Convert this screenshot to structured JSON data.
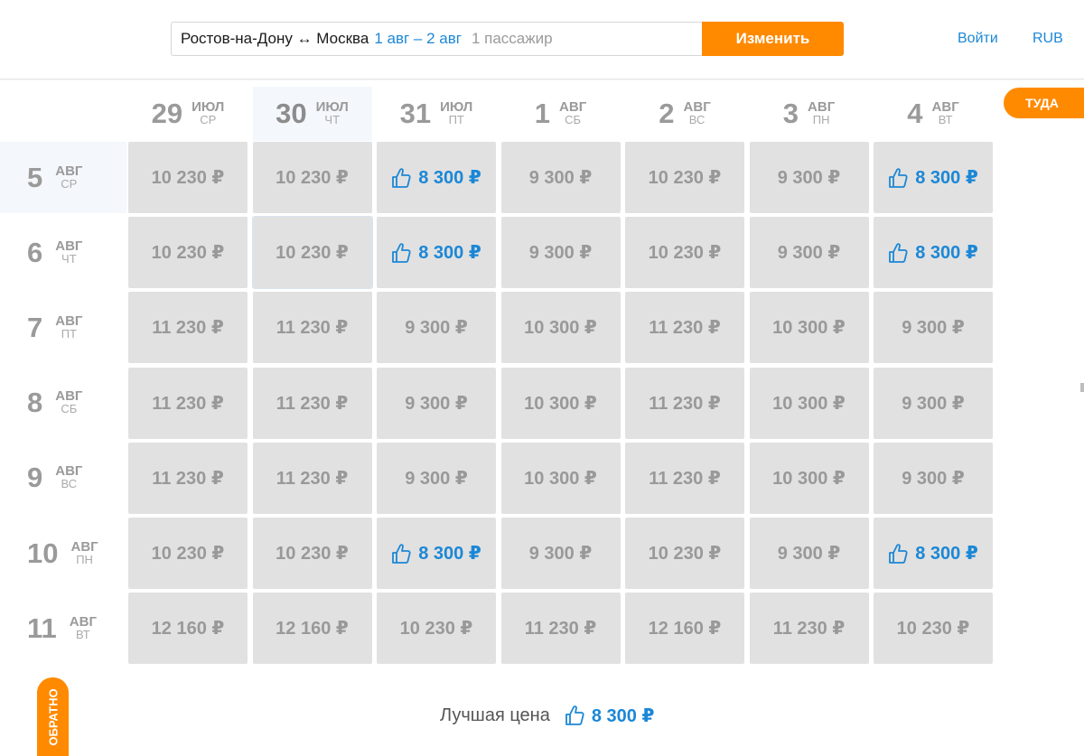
{
  "header": {
    "route": "Ростов-на-Дону ↔ Москва",
    "dates": "1 авг – 2 авг",
    "passengers": "1 пассажир",
    "change_button": "Изменить",
    "login": "Войти",
    "currency": "RUB"
  },
  "tabs": {
    "there": "ТУДА",
    "back": "ОБРАТНО"
  },
  "columns": [
    {
      "day": "29",
      "month": "ИЮЛ",
      "weekday": "СР",
      "highlight": false
    },
    {
      "day": "30",
      "month": "ИЮЛ",
      "weekday": "ЧТ",
      "highlight": true
    },
    {
      "day": "31",
      "month": "ИЮЛ",
      "weekday": "ПТ",
      "highlight": false
    },
    {
      "day": "1",
      "month": "АВГ",
      "weekday": "СБ",
      "highlight": false
    },
    {
      "day": "2",
      "month": "АВГ",
      "weekday": "ВС",
      "highlight": false
    },
    {
      "day": "3",
      "month": "АВГ",
      "weekday": "ПН",
      "highlight": false
    },
    {
      "day": "4",
      "month": "АВГ",
      "weekday": "ВТ",
      "highlight": false
    }
  ],
  "rows": [
    {
      "day": "5",
      "month": "АВГ",
      "weekday": "СР",
      "highlight": true
    },
    {
      "day": "6",
      "month": "АВГ",
      "weekday": "ЧТ",
      "highlight": false
    },
    {
      "day": "7",
      "month": "АВГ",
      "weekday": "ПТ",
      "highlight": false
    },
    {
      "day": "8",
      "month": "АВГ",
      "weekday": "СБ",
      "highlight": false
    },
    {
      "day": "9",
      "month": "АВГ",
      "weekday": "ВС",
      "highlight": false
    },
    {
      "day": "10",
      "month": "АВГ",
      "weekday": "ПН",
      "highlight": false
    },
    {
      "day": "11",
      "month": "АВГ",
      "weekday": "ВТ",
      "highlight": false
    }
  ],
  "prices": [
    [
      {
        "price": "10 230 ₽",
        "best": false
      },
      {
        "price": "10 230 ₽",
        "best": false
      },
      {
        "price": "8 300 ₽",
        "best": true
      },
      {
        "price": "9 300 ₽",
        "best": false
      },
      {
        "price": "10 230 ₽",
        "best": false
      },
      {
        "price": "9 300 ₽",
        "best": false
      },
      {
        "price": "8 300 ₽",
        "best": true
      }
    ],
    [
      {
        "price": "10 230 ₽",
        "best": false
      },
      {
        "price": "10 230 ₽",
        "best": false,
        "selected": true
      },
      {
        "price": "8 300 ₽",
        "best": true
      },
      {
        "price": "9 300 ₽",
        "best": false
      },
      {
        "price": "10 230 ₽",
        "best": false
      },
      {
        "price": "9 300 ₽",
        "best": false
      },
      {
        "price": "8 300 ₽",
        "best": true
      }
    ],
    [
      {
        "price": "11 230 ₽",
        "best": false
      },
      {
        "price": "11 230 ₽",
        "best": false
      },
      {
        "price": "9 300 ₽",
        "best": false
      },
      {
        "price": "10 300 ₽",
        "best": false
      },
      {
        "price": "11 230 ₽",
        "best": false
      },
      {
        "price": "10 300 ₽",
        "best": false
      },
      {
        "price": "9 300 ₽",
        "best": false
      }
    ],
    [
      {
        "price": "11 230 ₽",
        "best": false
      },
      {
        "price": "11 230 ₽",
        "best": false
      },
      {
        "price": "9 300 ₽",
        "best": false
      },
      {
        "price": "10 300 ₽",
        "best": false
      },
      {
        "price": "11 230 ₽",
        "best": false
      },
      {
        "price": "10 300 ₽",
        "best": false
      },
      {
        "price": "9 300 ₽",
        "best": false
      }
    ],
    [
      {
        "price": "11 230 ₽",
        "best": false
      },
      {
        "price": "11 230 ₽",
        "best": false
      },
      {
        "price": "9 300 ₽",
        "best": false
      },
      {
        "price": "10 300 ₽",
        "best": false
      },
      {
        "price": "11 230 ₽",
        "best": false
      },
      {
        "price": "10 300 ₽",
        "best": false
      },
      {
        "price": "9 300 ₽",
        "best": false
      }
    ],
    [
      {
        "price": "10 230 ₽",
        "best": false
      },
      {
        "price": "10 230 ₽",
        "best": false
      },
      {
        "price": "8 300 ₽",
        "best": true
      },
      {
        "price": "9 300 ₽",
        "best": false
      },
      {
        "price": "10 230 ₽",
        "best": false
      },
      {
        "price": "9 300 ₽",
        "best": false
      },
      {
        "price": "8 300 ₽",
        "best": true
      }
    ],
    [
      {
        "price": "12 160 ₽",
        "best": false
      },
      {
        "price": "12 160 ₽",
        "best": false
      },
      {
        "price": "10 230 ₽",
        "best": false
      },
      {
        "price": "11 230 ₽",
        "best": false
      },
      {
        "price": "12 160 ₽",
        "best": false
      },
      {
        "price": "11 230 ₽",
        "best": false
      },
      {
        "price": "10 230 ₽",
        "best": false
      }
    ]
  ],
  "footer": {
    "best_label": "Лучшая цена",
    "best_price": "8 300 ₽"
  },
  "colors": {
    "accent": "#ff8a00",
    "link": "#1b87d6",
    "cell_bg": "#e1e1e1",
    "cell_text": "#999999"
  }
}
